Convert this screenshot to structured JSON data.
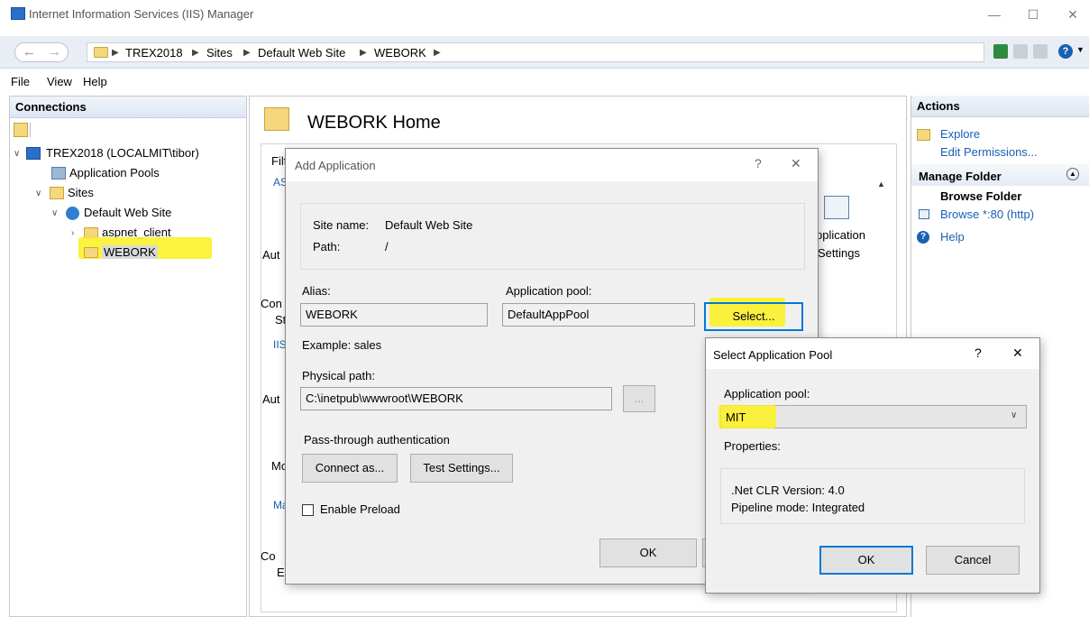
{
  "window": {
    "title": "Internet Information Services (IIS) Manager"
  },
  "address": {
    "crumbs": [
      "TREX2018",
      "Sites",
      "Default Web Site",
      "WEBORK"
    ]
  },
  "menu": [
    "File",
    "View",
    "Help"
  ],
  "connections": {
    "header": "Connections",
    "tree": {
      "server": "TREX2018 (LOCALMIT\\tibor)",
      "app_pools": "Application Pools",
      "sites": "Sites",
      "default_site": "Default Web Site",
      "aspnet_client": "aspnet_client",
      "webork": "WEBORK"
    }
  },
  "center": {
    "title": "WEBORK Home",
    "filter_label": "Filt",
    "frag": {
      "as": "AS",
      "aut1": "Aut",
      "con1": "Con",
      "st": "St",
      "iis": "IIS",
      "aut2": "Aut",
      "mo": "Mo",
      "ma": "Ma",
      "co2": "Co",
      "e": "E",
      "app_line1": "pplication",
      "app_line2": "Settings"
    }
  },
  "actions": {
    "header": "Actions",
    "explore": "Explore",
    "edit_permissions": "Edit Permissions...",
    "manage_folder": "Manage Folder",
    "browse_folder": "Browse Folder",
    "browse_http": "Browse *:80 (http)",
    "help": "Help"
  },
  "add_app": {
    "title": "Add Application",
    "help": "?",
    "close": "✕",
    "site_name_label": "Site name:",
    "site_name_value": "Default Web Site",
    "path_label": "Path:",
    "path_value": "/",
    "alias_label": "Alias:",
    "alias_value": "WEBORK",
    "pool_label": "Application pool:",
    "pool_value": "DefaultAppPool",
    "select_button": "Select...",
    "example": "Example: sales",
    "physical_label": "Physical path:",
    "physical_value": "C:\\inetpub\\wwwroot\\WEBORK",
    "browse_button": "...",
    "passthrough": "Pass-through authentication",
    "connect_as": "Connect as...",
    "test_settings": "Test Settings...",
    "enable_preload": "Enable Preload",
    "ok": "OK"
  },
  "select_pool": {
    "title": "Select Application Pool",
    "help": "?",
    "close": "✕",
    "pool_label": "Application pool:",
    "pool_value": "MIT",
    "properties_label": "Properties:",
    "clr": ".Net CLR Version: 4.0",
    "pipeline": "Pipeline mode: Integrated",
    "ok": "OK",
    "cancel": "Cancel"
  },
  "colors": {
    "accent": "#0078d7",
    "link": "#1a5fb4",
    "highlight": "#fbf01f"
  }
}
